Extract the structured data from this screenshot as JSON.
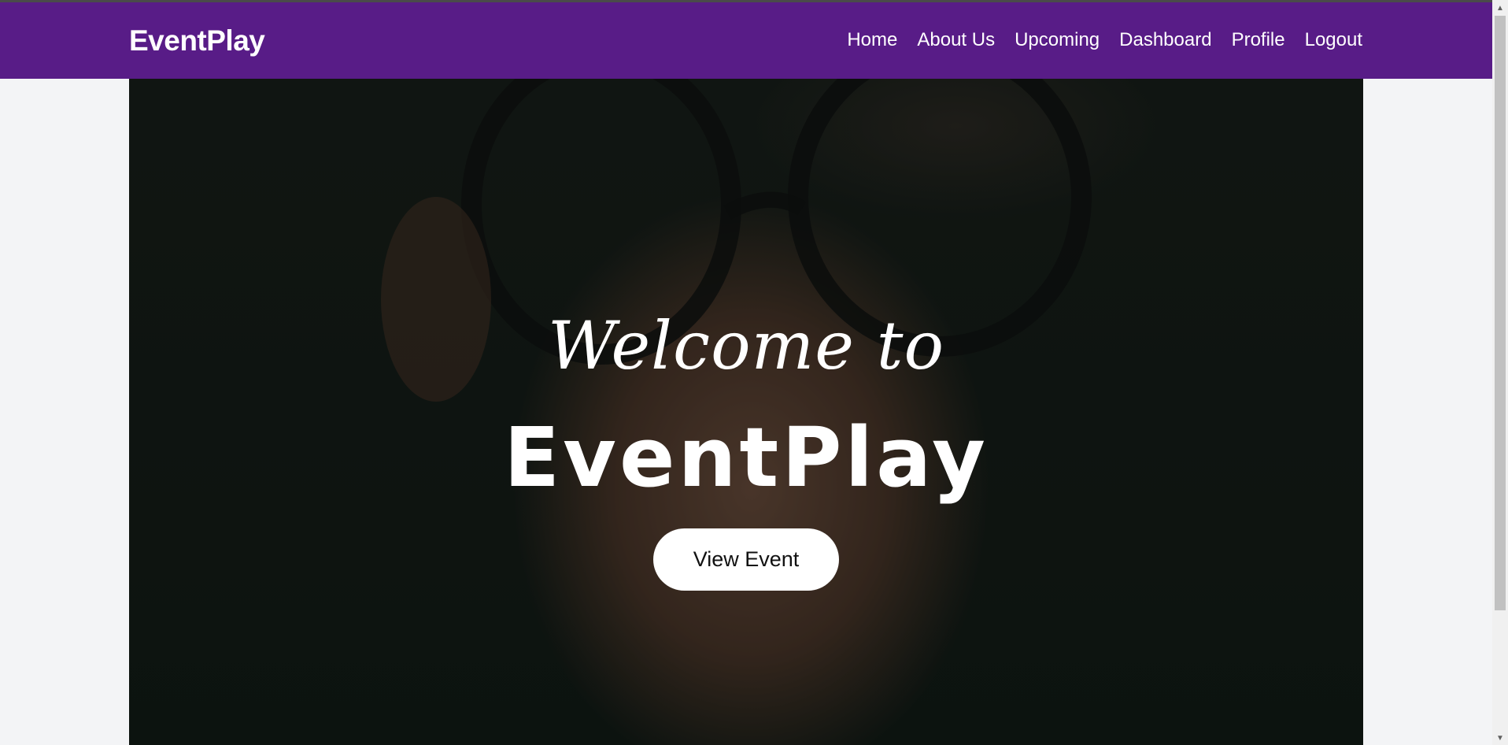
{
  "navbar": {
    "brand": "EventPlay",
    "links": [
      {
        "label": "Home"
      },
      {
        "label": "About Us"
      },
      {
        "label": "Upcoming"
      },
      {
        "label": "Dashboard"
      },
      {
        "label": "Profile"
      },
      {
        "label": "Logout"
      }
    ]
  },
  "hero": {
    "welcome": "Welcome to",
    "title": "EventPlay",
    "cta_label": "View Event"
  },
  "colors": {
    "navbar_bg": "#581c87",
    "page_bg": "#f3f4f6",
    "cta_bg": "#ffffff",
    "text_light": "#ffffff"
  },
  "icons": {
    "scroll_up": "scroll-up-arrow-icon",
    "scroll_down": "scroll-down-arrow-icon"
  }
}
